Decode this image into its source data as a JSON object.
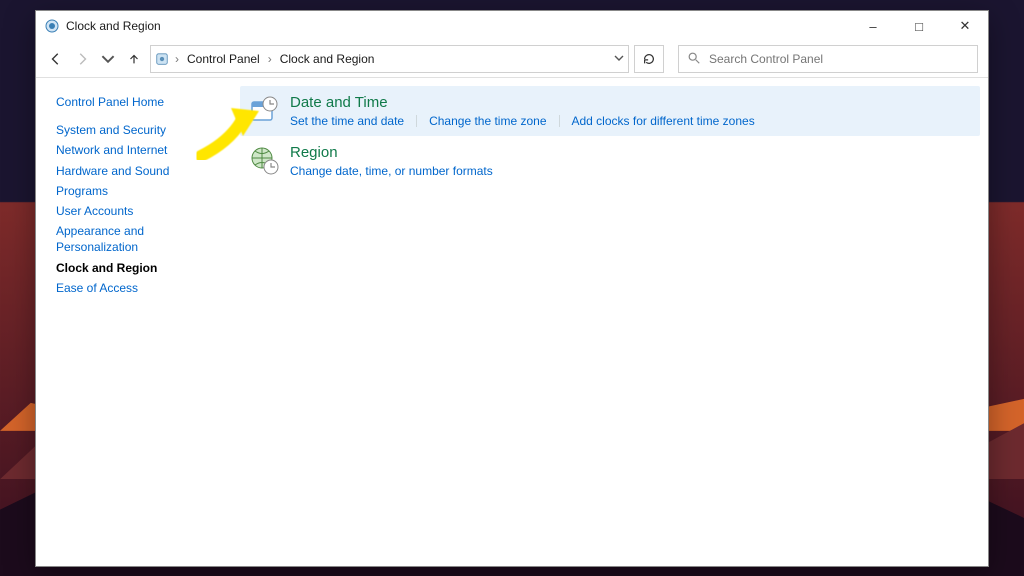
{
  "window": {
    "title": "Clock and Region"
  },
  "toolbar": {
    "breadcrumb": [
      "Control Panel",
      "Clock and Region"
    ],
    "search_placeholder": "Search Control Panel"
  },
  "sidebar": {
    "home": "Control Panel Home",
    "items": [
      "System and Security",
      "Network and Internet",
      "Hardware and Sound",
      "Programs",
      "User Accounts",
      "Appearance and Personalization",
      "Clock and Region",
      "Ease of Access"
    ],
    "current_index": 6
  },
  "content": {
    "categories": [
      {
        "title": "Date and Time",
        "highlight": true,
        "sublinks": [
          "Set the time and date",
          "Change the time zone",
          "Add clocks for different time zones"
        ]
      },
      {
        "title": "Region",
        "highlight": false,
        "sublinks": [
          "Change date, time, or number formats"
        ]
      }
    ]
  }
}
